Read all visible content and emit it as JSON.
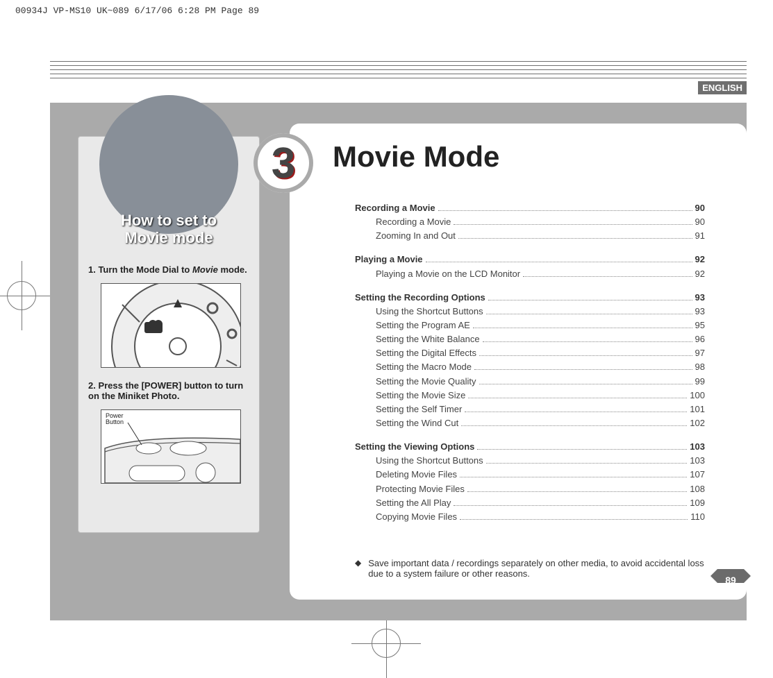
{
  "header_strip": "00934J VP-MS10 UK~089  6/17/06 6:28 PM  Page 89",
  "language_badge": "ENGLISH",
  "chapter_number": "3",
  "chapter_title": "Movie Mode",
  "page_number": "89",
  "sidebar": {
    "title_line1": "How to set to",
    "title_line2": "Movie mode",
    "step1_prefix": "1.  Turn the Mode Dial to ",
    "step1_italic": "Movie",
    "step1_suffix": " mode.",
    "step2": "2.  Press the [POWER] button to turn on the Miniket Photo.",
    "power_label": "Power\nButton"
  },
  "toc": [
    {
      "type": "head",
      "label": "Recording a Movie",
      "page": "90"
    },
    {
      "type": "sub",
      "label": "Recording a Movie",
      "page": "90"
    },
    {
      "type": "sub",
      "label": "Zooming In and Out",
      "page": "91"
    },
    {
      "type": "gap"
    },
    {
      "type": "head",
      "label": "Playing a Movie",
      "page": "92"
    },
    {
      "type": "sub",
      "label": "Playing a Movie on the LCD Monitor",
      "page": "92"
    },
    {
      "type": "gap"
    },
    {
      "type": "head",
      "label": "Setting the Recording Options",
      "page": "93"
    },
    {
      "type": "sub",
      "label": "Using the Shortcut Buttons",
      "page": "93"
    },
    {
      "type": "sub",
      "label": "Setting the Program AE",
      "page": "95"
    },
    {
      "type": "sub",
      "label": "Setting the White Balance",
      "page": "96"
    },
    {
      "type": "sub",
      "label": "Setting the Digital Effects",
      "page": "97"
    },
    {
      "type": "sub",
      "label": "Setting the Macro Mode",
      "page": "98"
    },
    {
      "type": "sub",
      "label": "Setting the Movie Quality",
      "page": "99"
    },
    {
      "type": "sub",
      "label": "Setting the Movie Size",
      "page": "100"
    },
    {
      "type": "sub",
      "label": "Setting the Self Timer",
      "page": "101"
    },
    {
      "type": "sub",
      "label": "Setting the Wind Cut",
      "page": "102"
    },
    {
      "type": "gap"
    },
    {
      "type": "head",
      "label": "Setting the Viewing Options",
      "page": "103"
    },
    {
      "type": "sub",
      "label": "Using the Shortcut Buttons",
      "page": "103"
    },
    {
      "type": "sub",
      "label": "Deleting Movie Files",
      "page": "107"
    },
    {
      "type": "sub",
      "label": "Protecting Movie Files",
      "page": "108"
    },
    {
      "type": "sub",
      "label": "Setting the All Play",
      "page": "109"
    },
    {
      "type": "sub",
      "label": "Copying Movie Files",
      "page": "110"
    }
  ],
  "note_bullet": "◆",
  "note_text": "Save important data / recordings separately on other media, to avoid accidental loss due to a system failure or other reasons."
}
